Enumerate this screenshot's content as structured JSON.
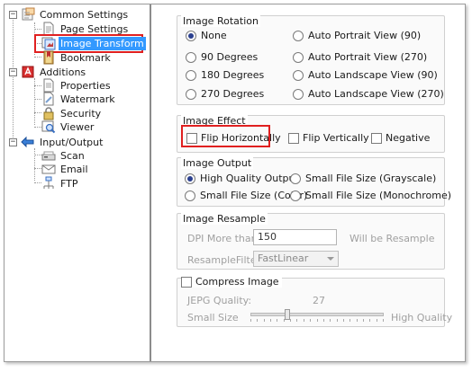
{
  "tree": {
    "groups": [
      {
        "label": "Common Settings",
        "expander": "−",
        "items": [
          {
            "label": "Page Settings"
          },
          {
            "label": "Image Transform",
            "selected": true
          },
          {
            "label": "Bookmark"
          }
        ]
      },
      {
        "label": "Additions",
        "expander": "−",
        "items": [
          {
            "label": "Properties"
          },
          {
            "label": "Watermark"
          },
          {
            "label": "Security"
          },
          {
            "label": "Viewer"
          }
        ]
      },
      {
        "label": "Input/Output",
        "expander": "−",
        "items": [
          {
            "label": "Scan"
          },
          {
            "label": "Email"
          },
          {
            "label": "FTP"
          }
        ]
      }
    ]
  },
  "rotation": {
    "title": "Image Rotation",
    "options": [
      {
        "label": "None",
        "checked": true
      },
      {
        "label": "90 Degrees",
        "checked": false
      },
      {
        "label": "180 Degrees",
        "checked": false
      },
      {
        "label": "270 Degrees",
        "checked": false
      },
      {
        "label": "Auto Portrait View (90)",
        "checked": false
      },
      {
        "label": "Auto Portrait View (270)",
        "checked": false
      },
      {
        "label": "Auto Landscape View (90)",
        "checked": false
      },
      {
        "label": "Auto Landscape View (270)",
        "checked": false
      }
    ]
  },
  "effect": {
    "title": "Image Effect",
    "flip_h": "Flip Horizontally",
    "flip_v": "Flip Vertically",
    "negative": "Negative"
  },
  "output": {
    "title": "Image Output",
    "options": [
      {
        "label": "High Quality Output",
        "checked": true
      },
      {
        "label": "Small File Size (Grayscale)",
        "checked": false
      },
      {
        "label": "Small File Size (Color)",
        "checked": false
      },
      {
        "label": "Small File Size (Monochrome)",
        "checked": false
      }
    ]
  },
  "resample": {
    "title": "Image Resample",
    "dpi_label": "DPI More than",
    "dpi_value": "150",
    "suffix": "Will be Resample",
    "filter_label": "ResampleFilter",
    "filter_value": "FastLinear"
  },
  "compress": {
    "label": "Compress Image",
    "quality_label": "JEPG Quality:",
    "quality_value": "27",
    "quality_fraction": 0.27,
    "small_label": "Small Size",
    "high_label": "High Quality"
  },
  "colors": {
    "selection": "#3399ff",
    "highlight_box": "#e02020"
  }
}
